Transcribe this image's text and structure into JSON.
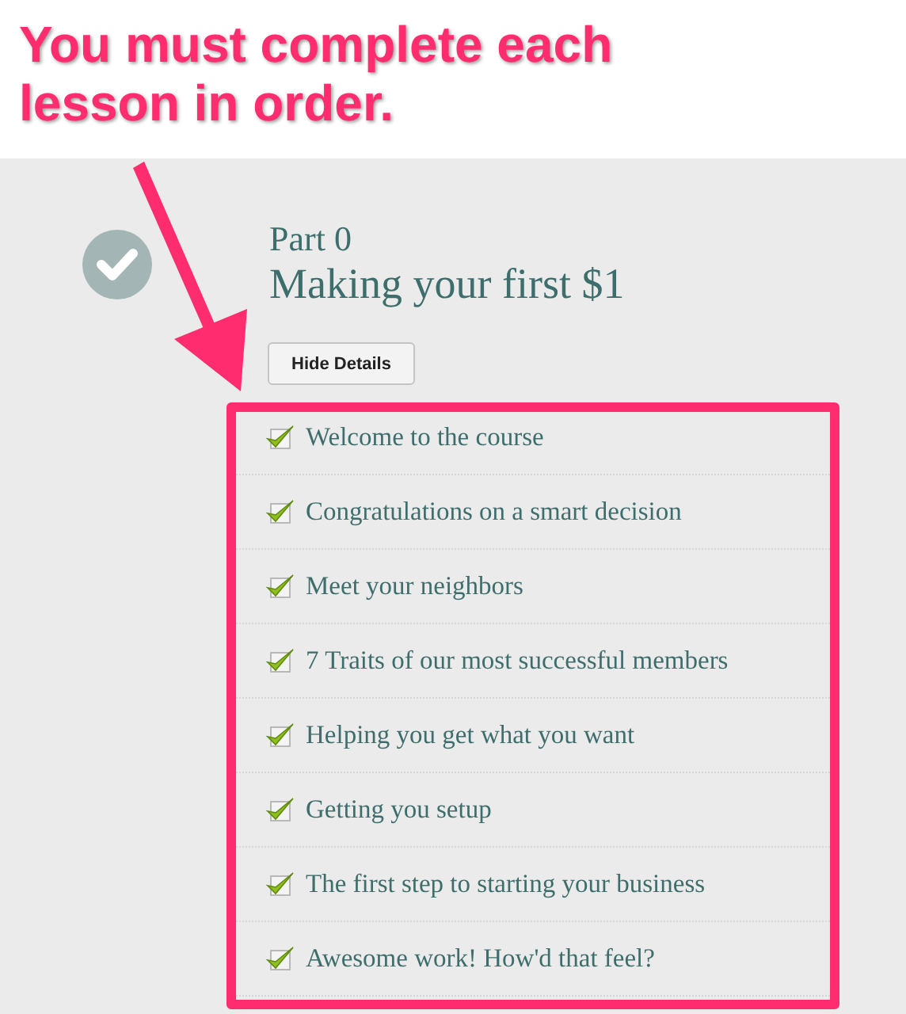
{
  "annotation": {
    "text": "You must complete each lesson in order."
  },
  "part": {
    "label": "Part 0",
    "title": "Making your first $1",
    "completed": true
  },
  "toggle_button": {
    "label": "Hide Details"
  },
  "lessons": [
    {
      "title": "Welcome to the course",
      "completed": true
    },
    {
      "title": "Congratulations on a smart decision",
      "completed": true
    },
    {
      "title": "Meet your neighbors",
      "completed": true
    },
    {
      "title": "7 Traits of our most successful members",
      "completed": true
    },
    {
      "title": "Helping you get what you want",
      "completed": true
    },
    {
      "title": "Getting you setup",
      "completed": true
    },
    {
      "title": "The first step to starting your business",
      "completed": true
    },
    {
      "title": "Awesome work! How'd that feel?",
      "completed": true
    }
  ]
}
